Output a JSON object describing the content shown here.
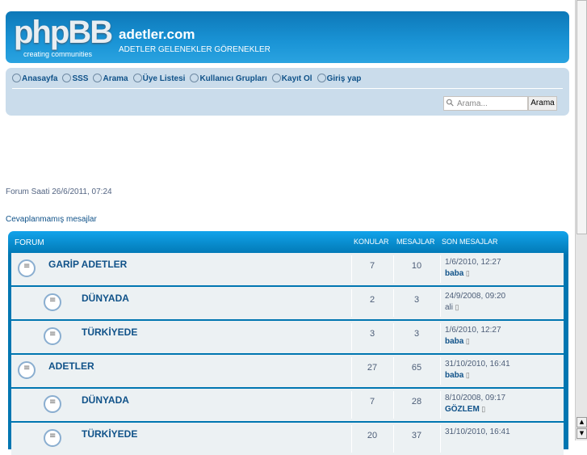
{
  "header": {
    "logo_text": "phpBB",
    "logo_tagline": "creating communities",
    "site_title": "adetler.com",
    "site_description": "ADETLER GELENEKLER GÖRENEKLER"
  },
  "nav": {
    "items": [
      {
        "label": "Anasayfa",
        "icon": "home-icon"
      },
      {
        "label": "SSS",
        "icon": "faq-icon"
      },
      {
        "label": "Arama",
        "icon": "search-icon"
      },
      {
        "label": "Üye Listesi",
        "icon": "member-icon"
      },
      {
        "label": "Kullanıcı Grupları",
        "icon": "groups-icon"
      },
      {
        "label": "Kayıt Ol",
        "icon": "register-icon"
      },
      {
        "label": "Giriş yap",
        "icon": "power-icon"
      }
    ]
  },
  "search": {
    "placeholder": "Arama...",
    "button": "Arama"
  },
  "forum_time": "Forum Saati 26/6/2011, 07:24",
  "unanswered": "Cevaplanmamış mesajlar",
  "table": {
    "headers": {
      "forum": "FORUM",
      "topics": "KONULAR",
      "posts": "MESAJLAR",
      "last": "SON MESAJLAR"
    },
    "rows": [
      {
        "title": "GARİP ADETLER",
        "topics": "7",
        "posts": "10",
        "date": "1/6/2010, 12:27",
        "user": "baba",
        "category": true
      },
      {
        "title": "DÜNYADA",
        "topics": "2",
        "posts": "3",
        "date": "24/9/2008, 09:20",
        "user": "ali",
        "category": false
      },
      {
        "title": "TÜRKİYEDE",
        "topics": "3",
        "posts": "3",
        "date": "1/6/2010, 12:27",
        "user": "baba",
        "category": false
      },
      {
        "title": "ADETLER",
        "topics": "27",
        "posts": "65",
        "date": "31/10/2010, 16:41",
        "user": "baba",
        "category": true
      },
      {
        "title": "DÜNYADA",
        "topics": "7",
        "posts": "28",
        "date": "8/10/2008, 09:17",
        "user": "GÖZLEM",
        "category": false
      },
      {
        "title": "TÜRKİYEDE",
        "topics": "20",
        "posts": "37",
        "date": "31/10/2010, 16:41",
        "user": "",
        "category": false
      }
    ]
  }
}
